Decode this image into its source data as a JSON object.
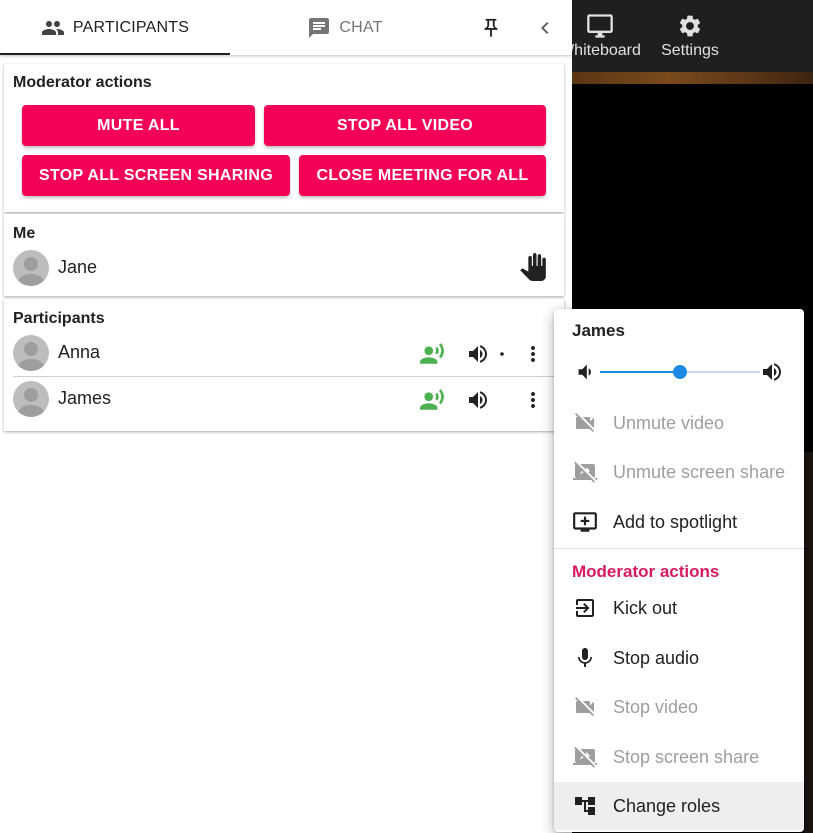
{
  "topbar": {
    "whiteboard_label": "Whiteboard",
    "settings_label": "Settings"
  },
  "tabs": [
    {
      "label": "PARTICIPANTS",
      "icon": "people-icon",
      "active": true
    },
    {
      "label": "CHAT",
      "icon": "chat-icon",
      "active": false
    }
  ],
  "moderator_card": {
    "title": "Moderator actions",
    "buttons": [
      "MUTE ALL",
      "STOP ALL VIDEO",
      "STOP ALL SCREEN SHARING",
      "CLOSE MEETING FOR ALL"
    ]
  },
  "me_card": {
    "title": "Me",
    "name": "Jane",
    "icon": "raised-hand-icon"
  },
  "participants_card": {
    "title": "Participants",
    "rows": [
      {
        "name": "Anna"
      },
      {
        "name": "James"
      }
    ]
  },
  "menu": {
    "title": "James",
    "volume": 0.5,
    "items": [
      {
        "label": "Unmute video",
        "icon": "videocam-off-icon",
        "disabled": true
      },
      {
        "label": "Unmute screen share",
        "icon": "screen-share-off-icon",
        "disabled": true
      },
      {
        "label": "Add to spotlight",
        "icon": "add-to-queue-icon",
        "disabled": false
      }
    ],
    "moderator_heading": "Moderator actions",
    "moderator_items": [
      {
        "label": "Kick out",
        "icon": "exit-icon",
        "disabled": false
      },
      {
        "label": "Stop audio",
        "icon": "mic-icon",
        "disabled": false
      },
      {
        "label": "Stop video",
        "icon": "videocam-off-icon",
        "disabled": true
      },
      {
        "label": "Stop screen share",
        "icon": "screen-share-off-icon",
        "disabled": true
      },
      {
        "label": "Change roles",
        "icon": "account-tree-icon",
        "disabled": false,
        "highlighted": true
      }
    ]
  },
  "colors": {
    "accent": "#f50057",
    "moderator_heading": "#d81b60",
    "speaking": "#4caf50",
    "slider": "#1e88e5"
  }
}
